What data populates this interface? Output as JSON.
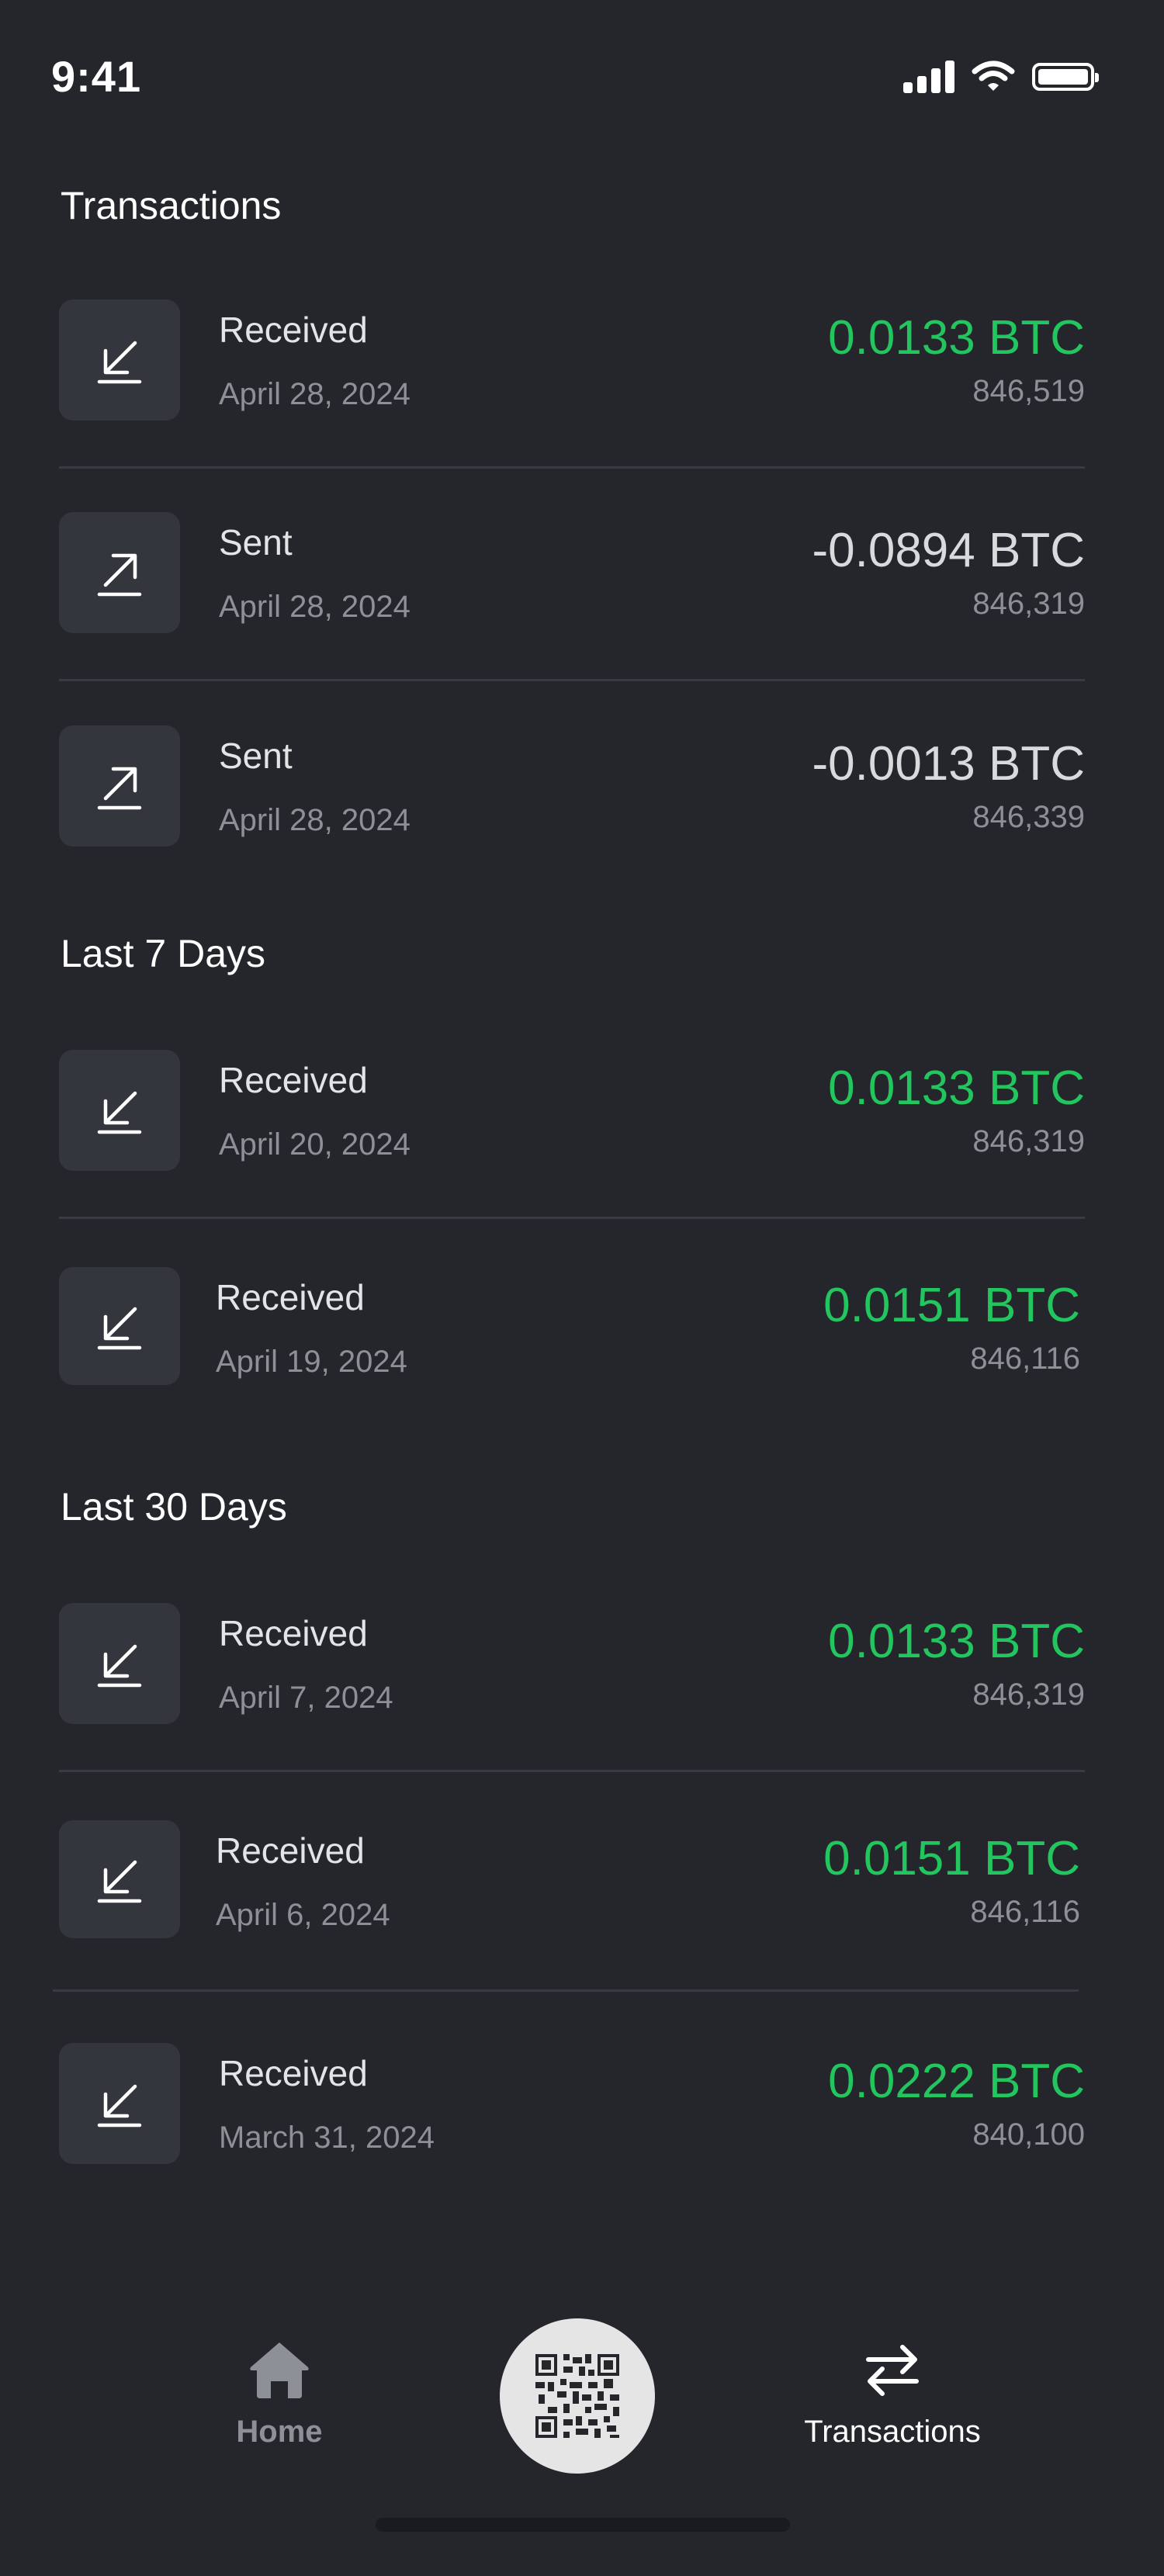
{
  "status_bar": {
    "time": "9:41"
  },
  "sections": [
    {
      "title": "Transactions",
      "items": [
        {
          "label": "Received",
          "date": "April 28, 2024",
          "amount": "0.0133 BTC",
          "block": "846,519",
          "direction": "received"
        },
        {
          "label": "Sent",
          "date": "April 28, 2024",
          "amount": "-0.0894 BTC",
          "block": "846,319",
          "direction": "sent"
        },
        {
          "label": "Sent",
          "date": "April 28, 2024",
          "amount": "-0.0013 BTC",
          "block": "846,339",
          "direction": "sent"
        }
      ]
    },
    {
      "title": "Last 7 Days",
      "items": [
        {
          "label": "Received",
          "date": "April 20, 2024",
          "amount": "0.0133 BTC",
          "block": "846,319",
          "direction": "received"
        },
        {
          "label": "Received",
          "date": "April 19, 2024",
          "amount": "0.0151 BTC",
          "block": "846,116",
          "direction": "received"
        }
      ]
    },
    {
      "title": "Last 30 Days",
      "items": [
        {
          "label": "Received",
          "date": "April 7, 2024",
          "amount": "0.0133 BTC",
          "block": "846,319",
          "direction": "received"
        },
        {
          "label": "Received",
          "date": "April 6, 2024",
          "amount": "0.0151 BTC",
          "block": "846,116",
          "direction": "received"
        },
        {
          "label": "Received",
          "date": "March 31, 2024",
          "amount": "0.0222 BTC",
          "block": "840,100",
          "direction": "received"
        }
      ]
    }
  ],
  "nav": {
    "home_label": "Home",
    "transactions_label": "Transactions",
    "active": "transactions",
    "icons": {
      "home": "home-icon",
      "scan": "qr-code-icon",
      "transactions": "swap-arrows-icon"
    }
  },
  "colors": {
    "background": "#24262b",
    "positive": "#22c55e",
    "muted": "#8d9096",
    "tile": "#33363c"
  }
}
